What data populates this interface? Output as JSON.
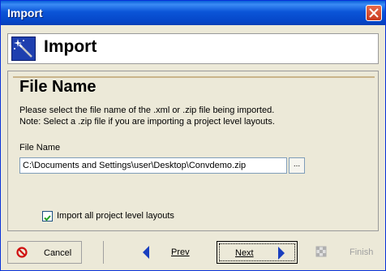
{
  "window": {
    "title": "Import"
  },
  "header": {
    "title": "Import"
  },
  "section": {
    "title": "File Name",
    "description_line1": "Please select the file name of the .xml or .zip file being imported.",
    "description_line2": "Note: Select a .zip file if you are importing a project level layouts."
  },
  "file_field": {
    "label": "File Name",
    "value": "C:\\Documents and Settings\\user\\Desktop\\Convdemo.zip",
    "browse_label": "..."
  },
  "options": {
    "import_all_label": "Import all project level layouts",
    "import_all_checked": true
  },
  "buttons": {
    "cancel": "Cancel",
    "prev": "Prev",
    "next": "Next",
    "finish": "Finish"
  },
  "colors": {
    "titlebar": "#0a5fd8",
    "close": "#c8391f",
    "accent_arrow": "#1a3fbf"
  }
}
